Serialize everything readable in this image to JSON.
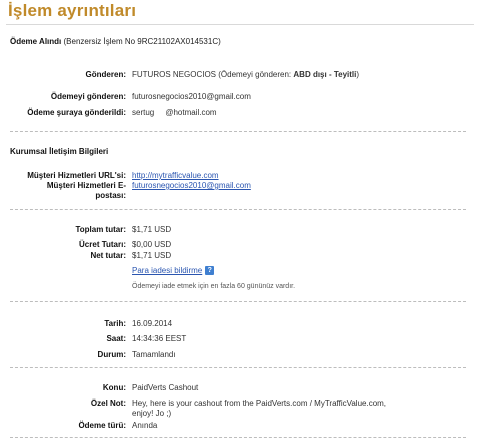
{
  "page_title": "İşlem ayrıntıları",
  "payment_received": {
    "label": "Ödeme Alındı",
    "value": "(Benzersiz İşlem No 9RC21102AX014531C)"
  },
  "sender_section": {
    "rows": [
      {
        "label": "Gönderen:",
        "value_pre": "FUTUROS NEGOCIOS (Ödemeyi gönderen: ",
        "value_bold": "ABD dışı - Teyitli",
        "value_post": ")"
      },
      {
        "label": "Ödemeyi gönderen:",
        "value": "futurosnegocios2010@gmail.com"
      },
      {
        "label": "Ödeme şuraya gönderildi:",
        "value": "sertug     @hotmail.com"
      }
    ]
  },
  "corporate": {
    "heading": "Kurumsal İletişim Bilgileri",
    "url_label": "Müşteri Hizmetleri URL'si:",
    "url_value": "http://mytrafficvalue.com",
    "email_label_1": "Müşteri Hizmetleri E-",
    "email_label_2": "postası:",
    "email_value": "futurosnegocios2010@gmail.com"
  },
  "amounts": {
    "total_label": "Toplam tutar:",
    "total_value": "$1,71 USD",
    "fee_label": "Ücret Tutarı:",
    "fee_value": "$0,00 USD",
    "net_label": "Net tutar:",
    "net_value": "$1,71 USD",
    "refund_link": "Para iadesi bildirme",
    "help_symbol": "?",
    "refund_note": "Ödemeyi iade etmek için en fazla 60 gününüz vardır."
  },
  "status": {
    "date_label": "Tarih:",
    "date_value": "16.09.2014",
    "time_label": "Saat:",
    "time_value": "14:34:36 EEST",
    "state_label": "Durum:",
    "state_value": "Tamamlandı"
  },
  "message": {
    "subject_label": "Konu:",
    "subject_value": "PaidVerts Cashout",
    "note_label": "Özel Not:",
    "note_line1": "Hey, here is your cashout from the PaidVerts.com / MyTrafficValue.com,",
    "note_line2": "enjoy! Jo ;)",
    "paytype_label": "Ödeme türü:",
    "paytype_value": "Anında"
  },
  "colors": {
    "title": "#c08a2a",
    "link": "#2a55b0",
    "help_icon_bg": "#3f7fd0",
    "separator": "#bdbdbd"
  }
}
